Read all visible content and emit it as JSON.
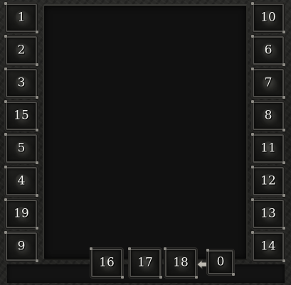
{
  "left_column": [
    "1",
    "2",
    "3",
    "15",
    "5",
    "4",
    "19",
    "9"
  ],
  "right_column": [
    "10",
    "6",
    "7",
    "8",
    "11",
    "12",
    "13",
    "14"
  ],
  "bottom_row": [
    "16",
    "17",
    "18",
    "0"
  ],
  "colors": {
    "frame": "#22221f",
    "panel": "#111111",
    "slot_border": "#4a4946",
    "label": "#f4f4f0"
  },
  "icons": {
    "swap": "arrow-left-icon"
  }
}
